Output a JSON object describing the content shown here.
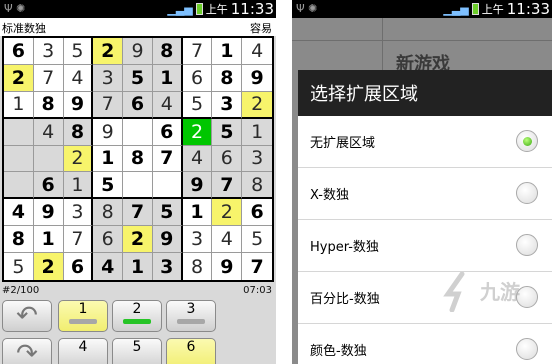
{
  "left_screen": {
    "status": {
      "ampm": "上午",
      "time": "11:33"
    },
    "title": "标准数独",
    "difficulty": "容易",
    "grid": [
      [
        {
          "v": "6",
          "t": "g"
        },
        {
          "v": "3",
          "t": "u"
        },
        {
          "v": "5",
          "t": "u"
        },
        {
          "v": "2",
          "t": "g",
          "h": 1
        },
        {
          "v": "9",
          "t": "u",
          "s": 1
        },
        {
          "v": "8",
          "t": "g",
          "s": 1
        },
        {
          "v": "7",
          "t": "u"
        },
        {
          "v": "1",
          "t": "g"
        },
        {
          "v": "4",
          "t": "u"
        }
      ],
      [
        {
          "v": "2",
          "t": "g",
          "h": 1
        },
        {
          "v": "7",
          "t": "u"
        },
        {
          "v": "4",
          "t": "u"
        },
        {
          "v": "3",
          "t": "u",
          "s": 1
        },
        {
          "v": "5",
          "t": "g",
          "s": 1
        },
        {
          "v": "1",
          "t": "g",
          "s": 1
        },
        {
          "v": "6",
          "t": "u"
        },
        {
          "v": "8",
          "t": "g"
        },
        {
          "v": "9",
          "t": "g"
        }
      ],
      [
        {
          "v": "1",
          "t": "u"
        },
        {
          "v": "8",
          "t": "g"
        },
        {
          "v": "9",
          "t": "g"
        },
        {
          "v": "7",
          "t": "u",
          "s": 1
        },
        {
          "v": "6",
          "t": "g",
          "s": 1
        },
        {
          "v": "4",
          "t": "u",
          "s": 1
        },
        {
          "v": "5",
          "t": "u"
        },
        {
          "v": "3",
          "t": "g"
        },
        {
          "v": "2",
          "t": "u",
          "h": 1
        }
      ],
      [
        {
          "v": "",
          "t": "u",
          "s": 1
        },
        {
          "v": "4",
          "t": "u",
          "s": 1
        },
        {
          "v": "8",
          "t": "g",
          "s": 1
        },
        {
          "v": "9",
          "t": "u"
        },
        {
          "v": "",
          "t": "u"
        },
        {
          "v": "6",
          "t": "g"
        },
        {
          "v": "2",
          "t": "u",
          "sel": 1
        },
        {
          "v": "5",
          "t": "g",
          "s": 1
        },
        {
          "v": "1",
          "t": "u",
          "s": 1
        }
      ],
      [
        {
          "v": "",
          "t": "u",
          "s": 1
        },
        {
          "v": "",
          "t": "u",
          "s": 1
        },
        {
          "v": "2",
          "t": "u",
          "h": 1
        },
        {
          "v": "1",
          "t": "g"
        },
        {
          "v": "8",
          "t": "g"
        },
        {
          "v": "7",
          "t": "g"
        },
        {
          "v": "4",
          "t": "u",
          "s": 1
        },
        {
          "v": "6",
          "t": "u",
          "s": 1
        },
        {
          "v": "3",
          "t": "u",
          "s": 1
        }
      ],
      [
        {
          "v": "",
          "t": "u",
          "s": 1
        },
        {
          "v": "6",
          "t": "g",
          "s": 1
        },
        {
          "v": "1",
          "t": "u",
          "s": 1
        },
        {
          "v": "5",
          "t": "g"
        },
        {
          "v": "",
          "t": "u"
        },
        {
          "v": "",
          "t": "u"
        },
        {
          "v": "9",
          "t": "g",
          "s": 1
        },
        {
          "v": "7",
          "t": "g",
          "s": 1
        },
        {
          "v": "8",
          "t": "u",
          "s": 1
        }
      ],
      [
        {
          "v": "4",
          "t": "g"
        },
        {
          "v": "9",
          "t": "g"
        },
        {
          "v": "3",
          "t": "u"
        },
        {
          "v": "8",
          "t": "u",
          "s": 1
        },
        {
          "v": "7",
          "t": "g",
          "s": 1
        },
        {
          "v": "5",
          "t": "g",
          "s": 1
        },
        {
          "v": "1",
          "t": "g"
        },
        {
          "v": "2",
          "t": "u",
          "h": 1
        },
        {
          "v": "6",
          "t": "g"
        }
      ],
      [
        {
          "v": "8",
          "t": "g"
        },
        {
          "v": "1",
          "t": "g"
        },
        {
          "v": "7",
          "t": "u"
        },
        {
          "v": "6",
          "t": "u",
          "s": 1
        },
        {
          "v": "2",
          "t": "g",
          "h": 1
        },
        {
          "v": "9",
          "t": "g",
          "s": 1
        },
        {
          "v": "3",
          "t": "u"
        },
        {
          "v": "4",
          "t": "u"
        },
        {
          "v": "5",
          "t": "u"
        }
      ],
      [
        {
          "v": "5",
          "t": "u"
        },
        {
          "v": "2",
          "t": "g",
          "h": 1
        },
        {
          "v": "6",
          "t": "g"
        },
        {
          "v": "4",
          "t": "g",
          "s": 1
        },
        {
          "v": "1",
          "t": "g",
          "s": 1
        },
        {
          "v": "3",
          "t": "g",
          "s": 1
        },
        {
          "v": "8",
          "t": "u"
        },
        {
          "v": "9",
          "t": "g"
        },
        {
          "v": "7",
          "t": "g"
        }
      ]
    ],
    "puzzle_no": "#2/100",
    "timer": "07:03",
    "keypad": [
      "1",
      "2",
      "3",
      "4",
      "5",
      "6"
    ]
  },
  "right_screen": {
    "status": {
      "ampm": "上午",
      "time": "11:33"
    },
    "background_title": "新游戏",
    "dialog_title": "选择扩展区域",
    "options": [
      {
        "label": "无扩展区域",
        "selected": true
      },
      {
        "label": "X-数独",
        "selected": false
      },
      {
        "label": "Hyper-数独",
        "selected": false
      },
      {
        "label": "百分比-数独",
        "selected": false
      },
      {
        "label": "颜色-数独",
        "selected": false
      }
    ],
    "watermark": "九游"
  },
  "colors": {
    "highlight": "#f7f46b",
    "selected_cell": "#00c600",
    "shaded_box": "#d9d9d9",
    "dialog_title_bg": "#222222"
  }
}
